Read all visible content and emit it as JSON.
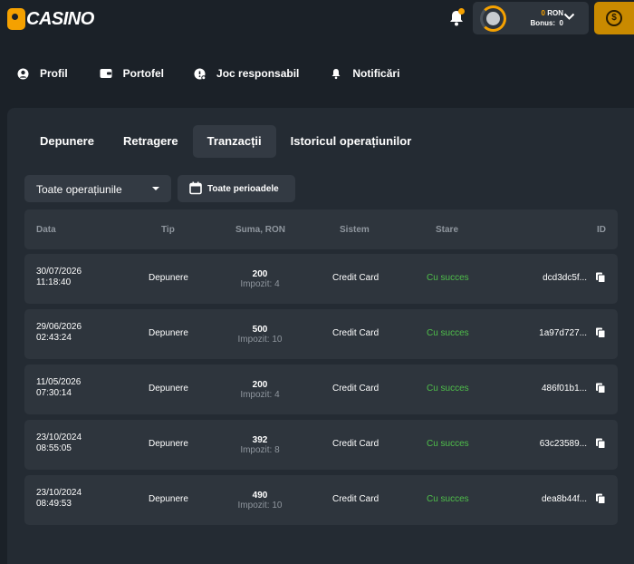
{
  "header": {
    "logo_text": "CASINO",
    "balance_amount": "0",
    "balance_currency": "RON",
    "bonus_label": "Bonus:",
    "bonus_value": "0",
    "deposit_symbol": "$",
    "accent_color": "#f5a100"
  },
  "nav": {
    "items": [
      {
        "label": "Profil",
        "icon": "user-circle-icon"
      },
      {
        "label": "Portofel",
        "icon": "wallet-icon"
      },
      {
        "label": "Joc responsabil",
        "icon": "responsible-gaming-icon"
      },
      {
        "label": "Notificări",
        "icon": "bell-icon"
      }
    ]
  },
  "tabs": [
    {
      "label": "Depunere",
      "active": false
    },
    {
      "label": "Retragere",
      "active": false
    },
    {
      "label": "Tranzacții",
      "active": true
    },
    {
      "label": "Istoricul operațiunilor",
      "active": false
    }
  ],
  "filters": {
    "operation_select": "Toate operațiunile",
    "period_button": "Toate perioadele"
  },
  "table": {
    "columns": [
      "Data",
      "Tip",
      "Suma, RON",
      "Sistem",
      "Stare",
      "ID"
    ],
    "rows": [
      {
        "date": "30/07/2026",
        "time": "11:18:40",
        "type": "Depunere",
        "sum": "200",
        "tax": "Impozit: 4",
        "system": "Credit Card",
        "status": "Cu succes",
        "id": "dcd3dc5f..."
      },
      {
        "date": "29/06/2026",
        "time": "02:43:24",
        "type": "Depunere",
        "sum": "500",
        "tax": "Impozit: 10",
        "system": "Credit Card",
        "status": "Cu succes",
        "id": "1a97d727..."
      },
      {
        "date": "11/05/2026",
        "time": "07:30:14",
        "type": "Depunere",
        "sum": "200",
        "tax": "Impozit: 4",
        "system": "Credit Card",
        "status": "Cu succes",
        "id": "486f01b1..."
      },
      {
        "date": "23/10/2024",
        "time": "08:55:05",
        "type": "Depunere",
        "sum": "392",
        "tax": "Impozit: 8",
        "system": "Credit Card",
        "status": "Cu succes",
        "id": "63c23589..."
      },
      {
        "date": "23/10/2024",
        "time": "08:49:53",
        "type": "Depunere",
        "sum": "490",
        "tax": "Impozit: 10",
        "system": "Credit Card",
        "status": "Cu succes",
        "id": "dea8b44f..."
      }
    ]
  }
}
